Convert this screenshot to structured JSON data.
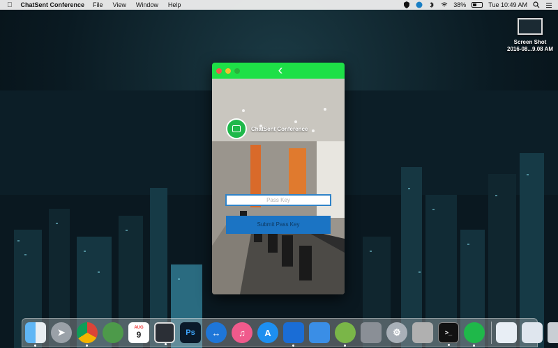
{
  "menubar": {
    "app_name": "ChatSent Conference",
    "menus": [
      "File",
      "View",
      "Window",
      "Help"
    ],
    "battery_percent": "38%",
    "clock": "Tue 10:49 AM"
  },
  "desktop": {
    "file_name_line1": "Screen Shot",
    "file_name_line2": "2016-08...9.08 AM"
  },
  "window": {
    "brand_name": "ChatSent Conference",
    "passkey_placeholder": "Pass Key",
    "submit_label": "Submit Pass Key"
  },
  "dock": {
    "apps": [
      "Finder",
      "Launchpad",
      "Chrome",
      "Network",
      "Calendar",
      "App",
      "Photoshop",
      "TeamViewer",
      "iTunes",
      "App Store",
      "Xcode",
      "Xcode Beta",
      "Android Studio",
      "System Preferences",
      "Settings",
      "Keychain",
      "Terminal",
      "ChatSent Conference"
    ],
    "calendar_month": "AUG",
    "calendar_day": "9",
    "ps_label": "Ps"
  },
  "colors": {
    "titlebar": "#1ee047",
    "brand_green": "#1fb84a",
    "button_blue": "#1b74c4"
  }
}
